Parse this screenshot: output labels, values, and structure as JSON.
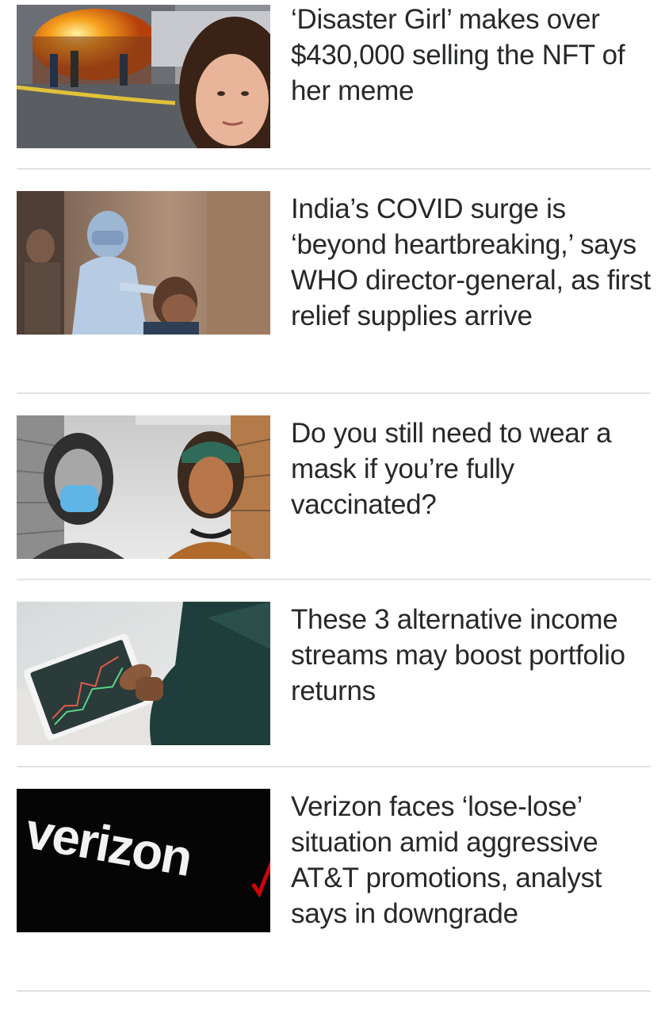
{
  "articles": [
    {
      "headline": "‘Disaster Girl’ makes over $430,000 selling the NFT of her meme",
      "thumbnail": "burning-house-girl-photo"
    },
    {
      "headline": "India’s COVID surge is ‘beyond heartbreaking,’ says WHO director-general, as first relief supplies arrive",
      "thumbnail": "covid-test-worker-photo"
    },
    {
      "headline": "Do you still need to wear a mask if you’re fully vaccinated?",
      "thumbnail": "two-women-mask-store-photo"
    },
    {
      "headline": "These 3 alternative income streams may boost portfolio returns",
      "thumbnail": "tablet-stock-chart-photo"
    },
    {
      "headline": "Verizon faces ‘lose-lose’ situation amid aggressive AT&T promotions, analyst says in downgrade",
      "thumbnail": "verizon-logo-photo",
      "thumbnail_text": "verizon"
    }
  ],
  "colors": {
    "text": "#26282a",
    "divider": "#e2e2e6",
    "verizon_red": "#cd040b"
  }
}
